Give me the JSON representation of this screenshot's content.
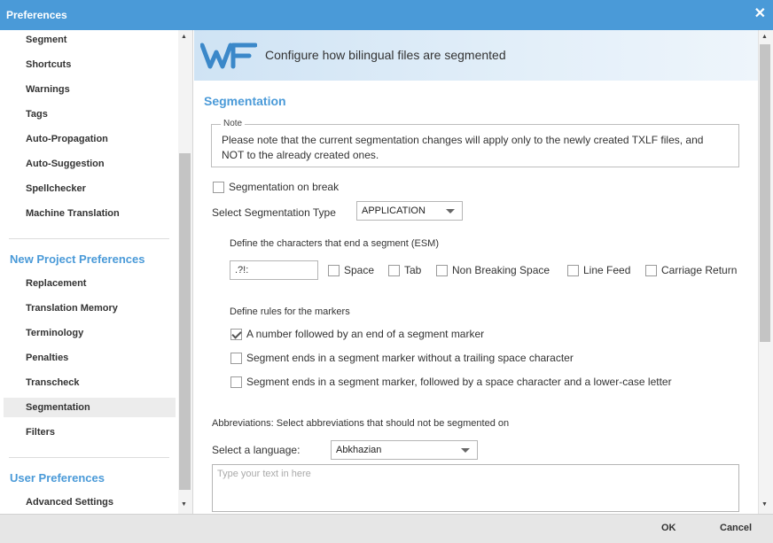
{
  "window": {
    "title": "Preferences",
    "close_glyph": "✕"
  },
  "sidebar": {
    "items_top": [
      {
        "label": "Segment"
      },
      {
        "label": "Shortcuts"
      },
      {
        "label": "Warnings"
      },
      {
        "label": "Tags"
      },
      {
        "label": "Auto-Propagation"
      },
      {
        "label": "Auto-Suggestion"
      },
      {
        "label": "Spellchecker"
      },
      {
        "label": "Machine Translation"
      }
    ],
    "section_new_project": "New Project Preferences",
    "items_project": [
      {
        "label": "Replacement"
      },
      {
        "label": "Translation Memory"
      },
      {
        "label": "Terminology"
      },
      {
        "label": "Penalties"
      },
      {
        "label": "Transcheck"
      },
      {
        "label": "Segmentation"
      },
      {
        "label": "Filters"
      }
    ],
    "section_user": "User Preferences",
    "items_user": [
      {
        "label": "Advanced Settings"
      }
    ],
    "active_item": "Segmentation"
  },
  "banner": {
    "text": "Configure how bilingual files are segmented",
    "logo": "wf-logo"
  },
  "segmentation": {
    "title": "Segmentation",
    "note_legend": "Note",
    "note_text": "Please note that the current segmentation changes will apply only to the newly created TXLF files, and NOT to the already created ones.",
    "on_break_label": "Segmentation on break",
    "on_break_checked": false,
    "type_label": "Select Segmentation Type",
    "type_value": "APPLICATION",
    "esm_label": "Define the characters that end a segment (ESM)",
    "esm_value": ".?!:",
    "esm_options": [
      {
        "label": "Space",
        "checked": false
      },
      {
        "label": "Tab",
        "checked": false
      },
      {
        "label": "Non Breaking Space",
        "checked": false
      },
      {
        "label": "Line Feed",
        "checked": false
      },
      {
        "label": "Carriage Return",
        "checked": false
      }
    ],
    "markers_label": "Define rules for the markers",
    "marker_rules": [
      {
        "label": "A number followed by an end of a segment marker",
        "checked": true
      },
      {
        "label": "Segment ends in a segment marker without a trailing space character",
        "checked": false
      },
      {
        "label": "Segment ends in a segment marker, followed by a space character and a lower-case letter",
        "checked": false
      }
    ],
    "abbrev_label": "Abbreviations: Select abbreviations that should not be segmented on",
    "language_label": "Select a language:",
    "language_value": "Abkhazian",
    "abbrev_placeholder": "Type your text in here"
  },
  "footer": {
    "ok_label": "OK",
    "cancel_label": "Cancel"
  },
  "colors": {
    "accent": "#4a9ad8",
    "footer": "#e6e6e6",
    "active_item_bg": "#ececec"
  }
}
